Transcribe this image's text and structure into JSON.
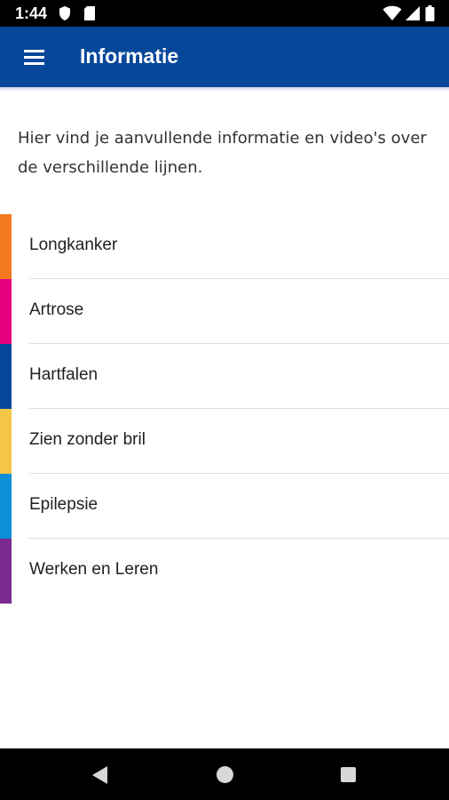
{
  "status_bar": {
    "time": "1:44",
    "icons": [
      "shield-icon",
      "sd-card-icon",
      "wifi-icon",
      "signal-icon",
      "battery-icon"
    ]
  },
  "app_bar": {
    "title": "Informatie",
    "background_color": "#06479a",
    "menu_icon": "hamburger-menu-icon"
  },
  "intro": {
    "text": "Hier vind je aanvullende informatie en video's over de verschillende lijnen."
  },
  "items": [
    {
      "label": "Longkanker",
      "color": "#f47920"
    },
    {
      "label": "Artrose",
      "color": "#e6007e"
    },
    {
      "label": "Hartfalen",
      "color": "#06479a"
    },
    {
      "label": "Zien zonder bril",
      "color": "#f5c645"
    },
    {
      "label": "Epilepsie",
      "color": "#0b8fd8"
    },
    {
      "label": "Werken en Leren",
      "color": "#7b2a8e"
    }
  ],
  "nav_bar": {
    "icons": [
      "back-icon",
      "home-icon",
      "recents-icon"
    ]
  }
}
